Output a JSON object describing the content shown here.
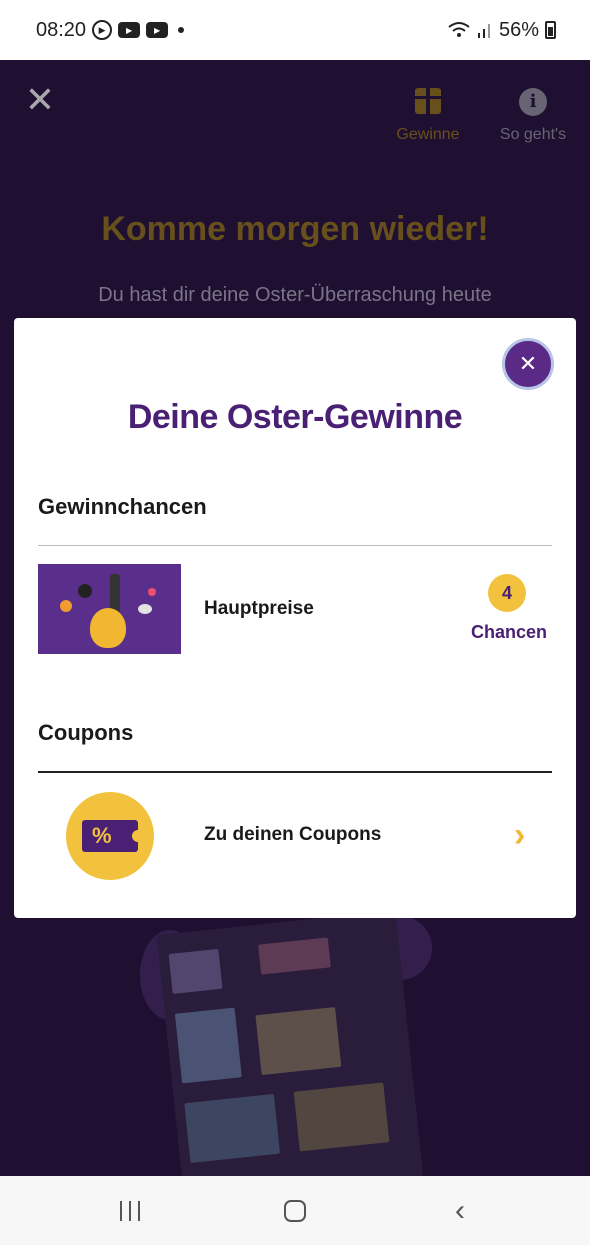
{
  "status_bar": {
    "time": "08:20",
    "battery": "56%",
    "icons": [
      "play-circle-icon",
      "youtube-icon",
      "youtube-icon",
      "dot-icon",
      "wifi-icon",
      "signal-icon",
      "battery-icon"
    ]
  },
  "background_screen": {
    "actions": [
      {
        "label": "Gewinne",
        "icon": "gift-icon"
      },
      {
        "label": "So geht's",
        "icon": "info-icon"
      }
    ],
    "title": "Komme morgen wieder!",
    "text": "Du hast dir deine Oster-Überraschung heute"
  },
  "modal": {
    "title": "Deine Oster-Gewinne",
    "sections": {
      "chances": {
        "heading": "Gewinnchancen",
        "item_label": "Hauptpreise",
        "count": "4",
        "count_label": "Chancen"
      },
      "coupons": {
        "heading": "Coupons",
        "link_label": "Zu deinen Coupons",
        "icon_glyph": "%"
      }
    }
  },
  "colors": {
    "brand_purple": "#4a2075",
    "accent_yellow": "#f2c23e",
    "background": "#2b1744"
  }
}
